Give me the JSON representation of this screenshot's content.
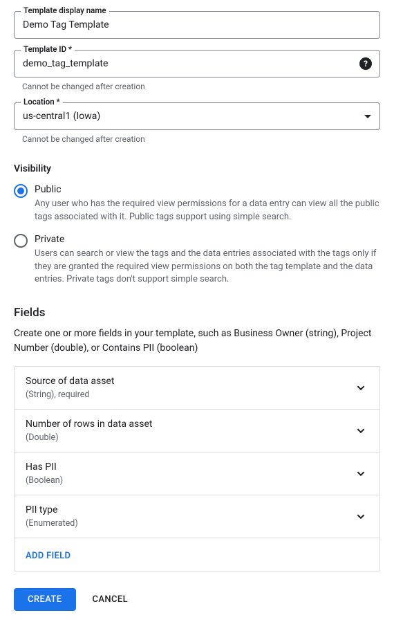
{
  "form": {
    "display_name": {
      "label": "Template display name",
      "value": "Demo Tag Template"
    },
    "template_id": {
      "label": "Template ID *",
      "value": "demo_tag_template",
      "helper": "Cannot be changed after creation"
    },
    "location": {
      "label": "Location *",
      "value": "us-central1 (Iowa)",
      "helper": "Cannot be changed after creation"
    }
  },
  "visibility": {
    "title": "Visibility",
    "options": {
      "public": {
        "label": "Public",
        "description": "Any user who has the required view permissions for a data entry can view all the public tags associated with it. Public tags support using simple search."
      },
      "private": {
        "label": "Private",
        "description": "Users can search or view the tags and the data entries associated with the tags only if they are granted the required view permissions on both the tag template and the data entries. Private tags don't support simple search."
      }
    }
  },
  "fields_section": {
    "title": "Fields",
    "description": "Create one or more fields in your template, such as Business Owner (string), Project Number (double), or Contains PII (boolean)",
    "items": [
      {
        "title": "Source of data asset",
        "type": "(String), required"
      },
      {
        "title": "Number of rows in data asset",
        "type": "(Double)"
      },
      {
        "title": "Has PII",
        "type": "(Boolean)"
      },
      {
        "title": "PII type",
        "type": "(Enumerated)"
      }
    ],
    "add_label": "ADD FIELD"
  },
  "buttons": {
    "create": "CREATE",
    "cancel": "CANCEL"
  }
}
